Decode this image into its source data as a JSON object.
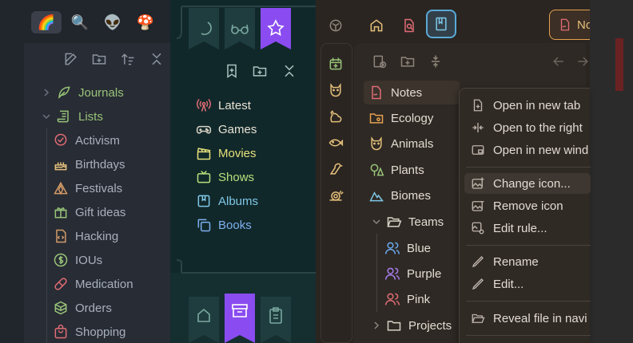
{
  "panel1": {
    "emoji_tabs": [
      "🌈",
      "🔍",
      "👽",
      "🍄"
    ],
    "tree": {
      "journals": "Journals",
      "lists": "Lists",
      "items": [
        "Activism",
        "Birthdays",
        "Festivals",
        "Gift ideas",
        "Hacking",
        "IOUs",
        "Medication",
        "Orders",
        "Shopping"
      ]
    },
    "colors": {
      "bg": "#282c34",
      "text": "#a9b0bd",
      "accent": "#98c379"
    }
  },
  "panel2": {
    "items": [
      "Latest",
      "Games",
      "Movies",
      "Shows",
      "Albums",
      "Books"
    ],
    "colors": {
      "bg": "#11282a",
      "ribbon": "#1f3d3e",
      "active_ribbon": "#8a4cf0"
    }
  },
  "panel3": {
    "tab_partial": "No",
    "tree": {
      "notes": "Notes",
      "ecology": "Ecology",
      "animals": "Animals",
      "plants": "Plants",
      "biomes": "Biomes",
      "teams": "Teams",
      "blue": "Blue",
      "purple": "Purple",
      "pink": "Pink",
      "projects": "Projects"
    },
    "menu": {
      "open_new_tab": "Open in new tab",
      "open_right": "Open to the right",
      "open_window": "Open in new wind",
      "change_icon": "Change icon...",
      "remove_icon": "Remove icon",
      "edit_rule": "Edit rule...",
      "rename": "Rename",
      "edit": "Edit...",
      "reveal": "Reveal file in navi"
    },
    "colors": {
      "bg": "#2a2521",
      "text": "#e3dbd2",
      "accent_red": "#e06c75"
    }
  }
}
